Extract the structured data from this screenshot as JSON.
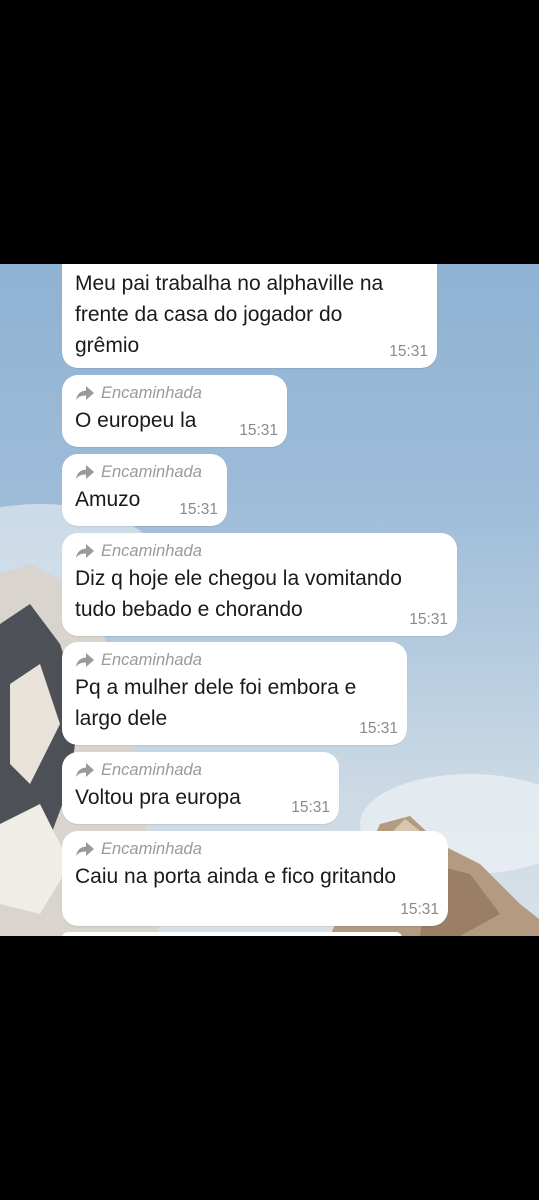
{
  "chat": {
    "forwarded_label": "Encaminhada",
    "messages": [
      {
        "text": "Meu pai trabalha no alphaville na\nfrente da casa do jogador do\ngrêmio",
        "time": "15:31",
        "forwarded": false
      },
      {
        "text": "O europeu la",
        "time": "15:31",
        "forwarded": true
      },
      {
        "text": "Amuzo",
        "time": "15:31",
        "forwarded": true
      },
      {
        "text": "Diz q hoje ele chegou la vomitando\ntudo bebado e chorando",
        "time": "15:31",
        "forwarded": true
      },
      {
        "text": "Pq a mulher dele foi embora e\nlargo dele",
        "time": "15:31",
        "forwarded": true
      },
      {
        "text": "Voltou pra europa",
        "time": "15:31",
        "forwarded": true
      },
      {
        "text": "Caiu na porta ainda e fico gritando",
        "time": "15:31",
        "forwarded": true
      }
    ]
  },
  "colors": {
    "bubble": "#ffffff",
    "text": "#1a1a1a",
    "meta": "#8a8a8a",
    "outer_background": "#000000"
  },
  "icons": {
    "forward": "forward-arrow-icon"
  }
}
